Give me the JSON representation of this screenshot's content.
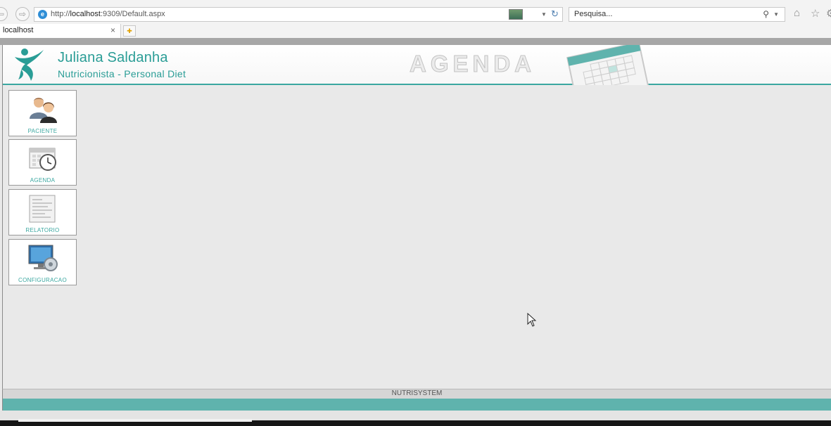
{
  "browser": {
    "url_prefix": "http://",
    "url_host": "localhost",
    "url_rest": ":9309/Default.aspx",
    "search_placeholder": "Pesquisa...",
    "tab_title": "localhost",
    "close_glyph": "×"
  },
  "header": {
    "name": "Juliana Saldanha",
    "subtitle": "Nutricionista - Personal Diet",
    "section_title": "AGENDA",
    "accent_color": "#2a9d96"
  },
  "menu": [
    {
      "label": "PACIENTE",
      "icon": "patients-icon"
    },
    {
      "label": "AGENDA",
      "icon": "calendar-clock-icon"
    },
    {
      "label": "RELATORIO",
      "icon": "report-icon"
    },
    {
      "label": "CONFIGURACAO",
      "icon": "settings-monitor-icon"
    }
  ],
  "footer": {
    "text": "NUTRISYSTEM",
    "bar_color": "#5fb3ad"
  }
}
